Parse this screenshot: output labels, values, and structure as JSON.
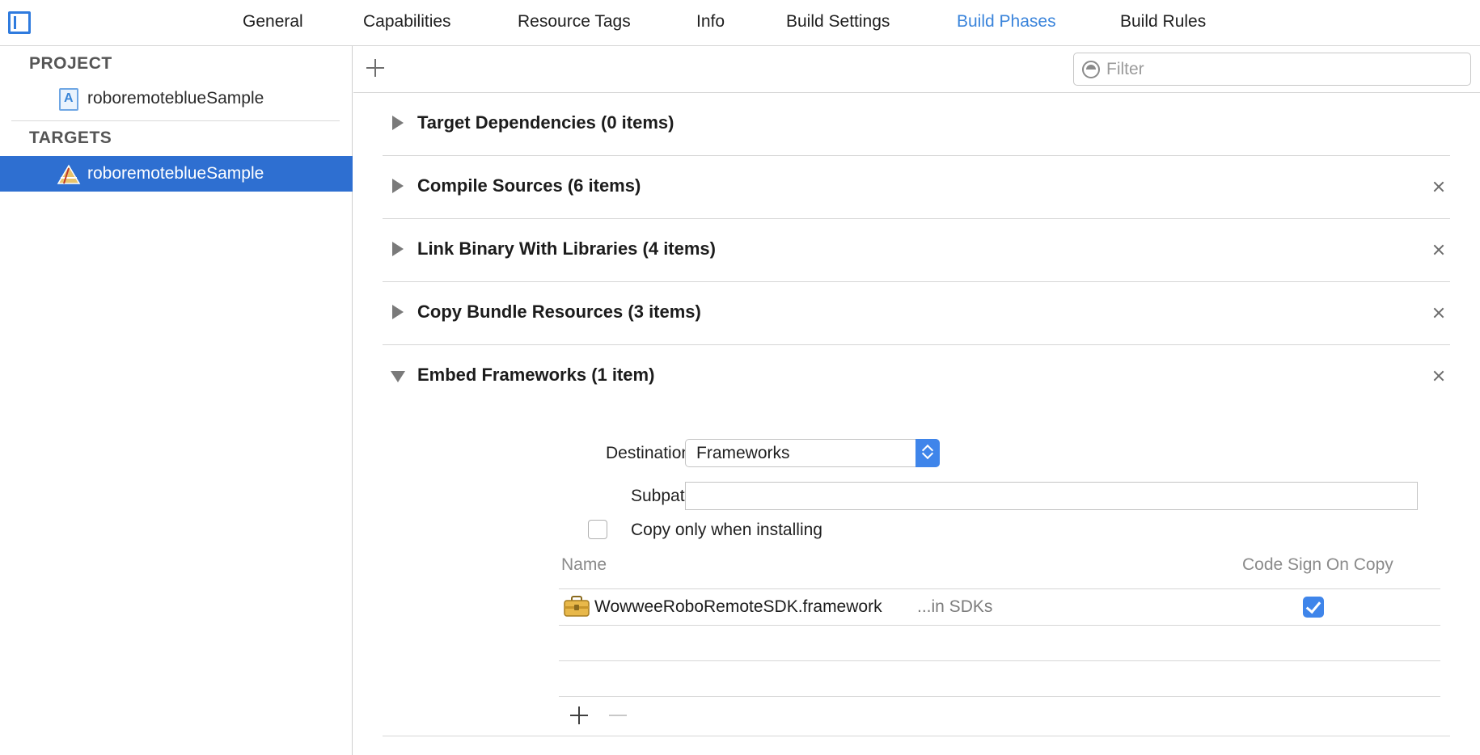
{
  "tabs": [
    {
      "label": "General",
      "active": false
    },
    {
      "label": "Capabilities",
      "active": false
    },
    {
      "label": "Resource Tags",
      "active": false
    },
    {
      "label": "Info",
      "active": false
    },
    {
      "label": "Build Settings",
      "active": false
    },
    {
      "label": "Build Phases",
      "active": true
    },
    {
      "label": "Build Rules",
      "active": false
    }
  ],
  "colors": {
    "accent": "#3a84db",
    "selection": "#2e6fd1",
    "checkbox": "#3f85ea"
  },
  "sidebar": {
    "project_header": "PROJECT",
    "project_item": {
      "label": "roboremoteblueSample",
      "icon": "project-file-icon"
    },
    "targets_header": "TARGETS",
    "target_item": {
      "label": "roboremoteblueSample",
      "icon": "app-target-icon",
      "selected": true
    }
  },
  "toolbar": {
    "filter_placeholder": "Filter"
  },
  "phases": [
    {
      "title": "Target Dependencies (0 items)",
      "expanded": false,
      "removable": false
    },
    {
      "title": "Compile Sources (6 items)",
      "expanded": false,
      "removable": true
    },
    {
      "title": "Link Binary With Libraries (4 items)",
      "expanded": false,
      "removable": true
    },
    {
      "title": "Copy Bundle Resources (3 items)",
      "expanded": false,
      "removable": true
    },
    {
      "title": "Embed Frameworks (1 item)",
      "expanded": true,
      "removable": true
    }
  ],
  "embed": {
    "destination_label": "Destination",
    "destination_value": "Frameworks",
    "subpath_label": "Subpath",
    "subpath_value": "",
    "copy_only_label": "Copy only when installing",
    "copy_only_checked": false,
    "columns": {
      "name": "Name",
      "code_sign": "Code Sign On Copy"
    },
    "files": [
      {
        "name": "WowweeRoboRemoteSDK.framework",
        "location": "...in SDKs",
        "code_sign_on_copy": true
      }
    ]
  }
}
